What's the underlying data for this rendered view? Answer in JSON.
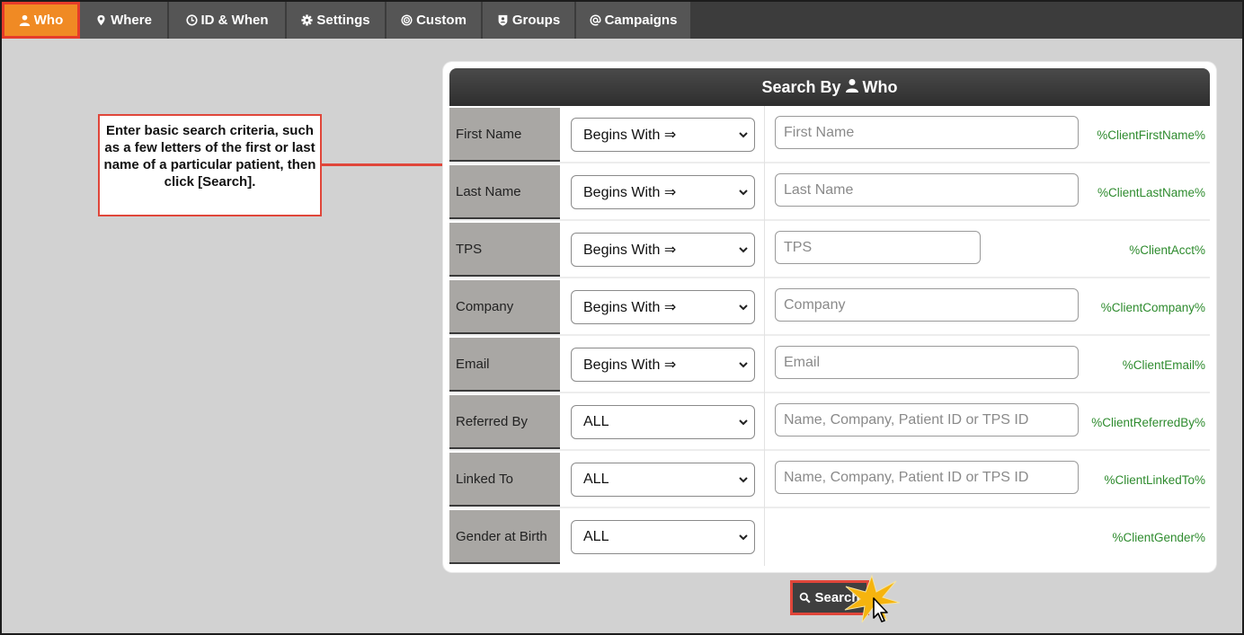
{
  "tabs": [
    {
      "label": "Who",
      "icon": "user-icon",
      "active": true
    },
    {
      "label": "Where",
      "icon": "map-pin-icon",
      "active": false
    },
    {
      "label": "ID & When",
      "icon": "clock-icon",
      "active": false
    },
    {
      "label": "Settings",
      "icon": "gear-icon",
      "active": false
    },
    {
      "label": "Custom",
      "icon": "target-icon",
      "active": false
    },
    {
      "label": "Groups",
      "icon": "badge-icon",
      "active": false
    },
    {
      "label": "Campaigns",
      "icon": "at-icon",
      "active": false
    }
  ],
  "panel": {
    "title": "Search By",
    "title_suffix": "Who",
    "rows": [
      {
        "label": "First Name",
        "match": "Begins With ⇒",
        "placeholder": "First Name",
        "variable": "%ClientFirstName%"
      },
      {
        "label": "Last Name",
        "match": "Begins With ⇒",
        "placeholder": "Last Name",
        "variable": "%ClientLastName%"
      },
      {
        "label": "TPS",
        "match": "Begins With ⇒",
        "placeholder": "TPS",
        "variable": "%ClientAcct%"
      },
      {
        "label": "Company",
        "match": "Begins With ⇒",
        "placeholder": "Company",
        "variable": "%ClientCompany%"
      },
      {
        "label": "Email",
        "match": "Begins With ⇒",
        "placeholder": "Email",
        "variable": "%ClientEmail%"
      },
      {
        "label": "Referred By",
        "match": "ALL",
        "placeholder": "Name, Company, Patient ID or TPS ID",
        "variable": "%ClientReferredBy%"
      },
      {
        "label": "Linked To",
        "match": "ALL",
        "placeholder": "Name, Company, Patient ID or TPS ID",
        "variable": "%ClientLinkedTo%"
      },
      {
        "label": "Gender at Birth",
        "match": "ALL",
        "placeholder": "",
        "variable": "%ClientGender%"
      }
    ]
  },
  "callout": {
    "text": "Enter basic search criteria, such as a few letters of the first or last name of a particular patient, then click [Search]."
  },
  "search_button": {
    "label": "Search",
    "icon": "search-icon"
  },
  "colors": {
    "active_tab": "#f08a24",
    "highlight": "#e0463a",
    "variable_text": "#2e8b2e",
    "label_bg": "#a9a7a4"
  }
}
